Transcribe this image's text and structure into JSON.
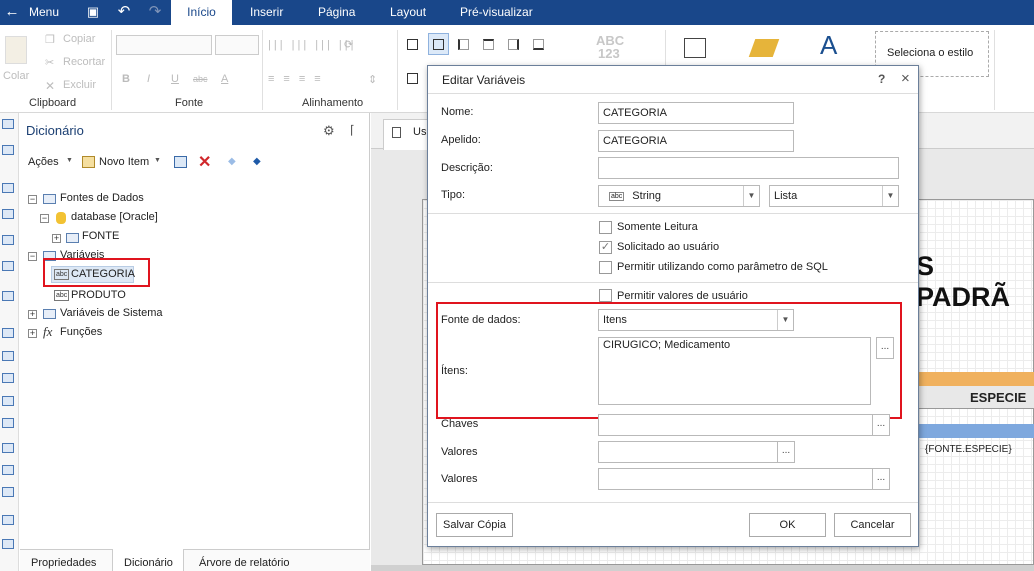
{
  "topbar": {
    "menu": "Menu",
    "tabs": [
      "Início",
      "Inserir",
      "Página",
      "Layout",
      "Pré-visualizar"
    ]
  },
  "ribbon": {
    "paste": "Colar",
    "copy": "Copiar",
    "cut": "Recortar",
    "delete": "Excluir",
    "groups": [
      "Clipboard",
      "Fonte",
      "Alinhamento"
    ],
    "style_box": "Seleciona o estilo",
    "abc": "ABC",
    "num": "123"
  },
  "dict": {
    "title": "Dicionário",
    "actions": "Ações",
    "new_item": "Novo Item",
    "tree": {
      "data_sources": "Fontes de Dados",
      "database": "database [Oracle]",
      "fonte": "FONTE",
      "variables": "Variáveis",
      "categoria": "CATEGORIA",
      "produto": "PRODUTO",
      "system_vars": "Variáveis de Sistema",
      "functions": "Funções"
    },
    "bottom_tabs": [
      "Propriedades",
      "Dicionário",
      "Árvore de relatório"
    ]
  },
  "design": {
    "tab": "Us",
    "banner": "S PADRÃ",
    "especie": "ESPECIE",
    "fonte_especie": "{FONTE.ESPECIE}"
  },
  "dialog": {
    "title": "Editar Variáveis",
    "help": "?",
    "close": "×",
    "nome_label": "Nome:",
    "nome": "CATEGORIA",
    "apelido_label": "Apelido:",
    "apelido": "CATEGORIA",
    "descricao_label": "Descrição:",
    "descricao": "",
    "tipo_label": "Tipo:",
    "tipo_icon": "abc",
    "tipo": "String",
    "tipo2": "Lista",
    "checks": [
      {
        "label": "Somente Leitura",
        "checked": false
      },
      {
        "label": "Solicitado ao usuário",
        "checked": true
      },
      {
        "label": "Permitir utilizando como parâmetro de SQL",
        "checked": false
      },
      {
        "label": "Permitir valores de usuário",
        "checked": false
      }
    ],
    "fonte_label": "Fonte de dados:",
    "fonte": "Itens",
    "itens_label": "Ítens:",
    "itens": "CIRUGICO; Medicamento",
    "chaves_label": "Chaves",
    "valores_label": "Valores",
    "valores2_label": "Valores",
    "dots": "...",
    "save_copy": "Salvar Cópia",
    "ok": "OK",
    "cancel": "Cancelar"
  }
}
